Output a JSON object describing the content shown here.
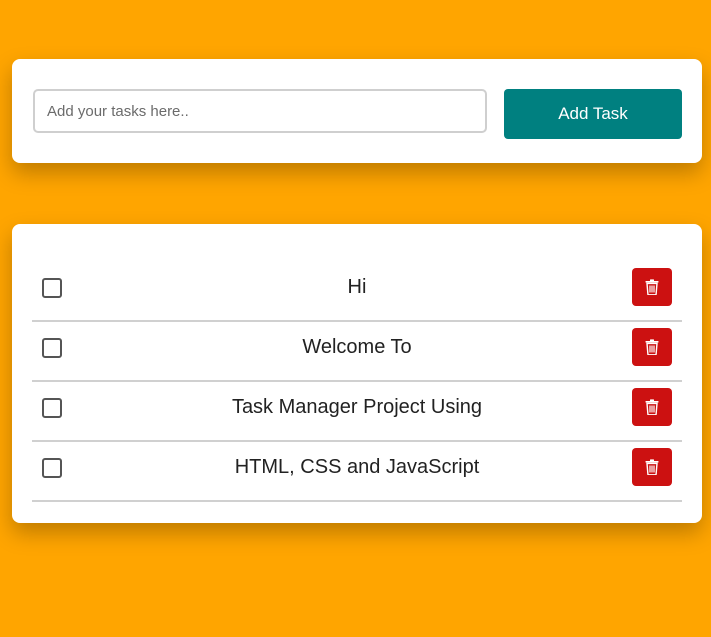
{
  "input_card": {
    "task_input": {
      "value": "",
      "placeholder": "Add your tasks here.."
    },
    "add_button_label": "Add Task"
  },
  "tasks": [
    {
      "text": "Hi",
      "checked": false,
      "delete_icon": "trash-icon"
    },
    {
      "text": "Welcome To",
      "checked": false,
      "delete_icon": "trash-icon"
    },
    {
      "text": "Task Manager Project Using",
      "checked": false,
      "delete_icon": "trash-icon"
    },
    {
      "text": "HTML, CSS and JavaScript",
      "checked": false,
      "delete_icon": "trash-icon"
    }
  ],
  "colors": {
    "background": "#FFA500",
    "card": "#FFFFFF",
    "add_button": "#008080",
    "delete_button": "#CC1111"
  }
}
